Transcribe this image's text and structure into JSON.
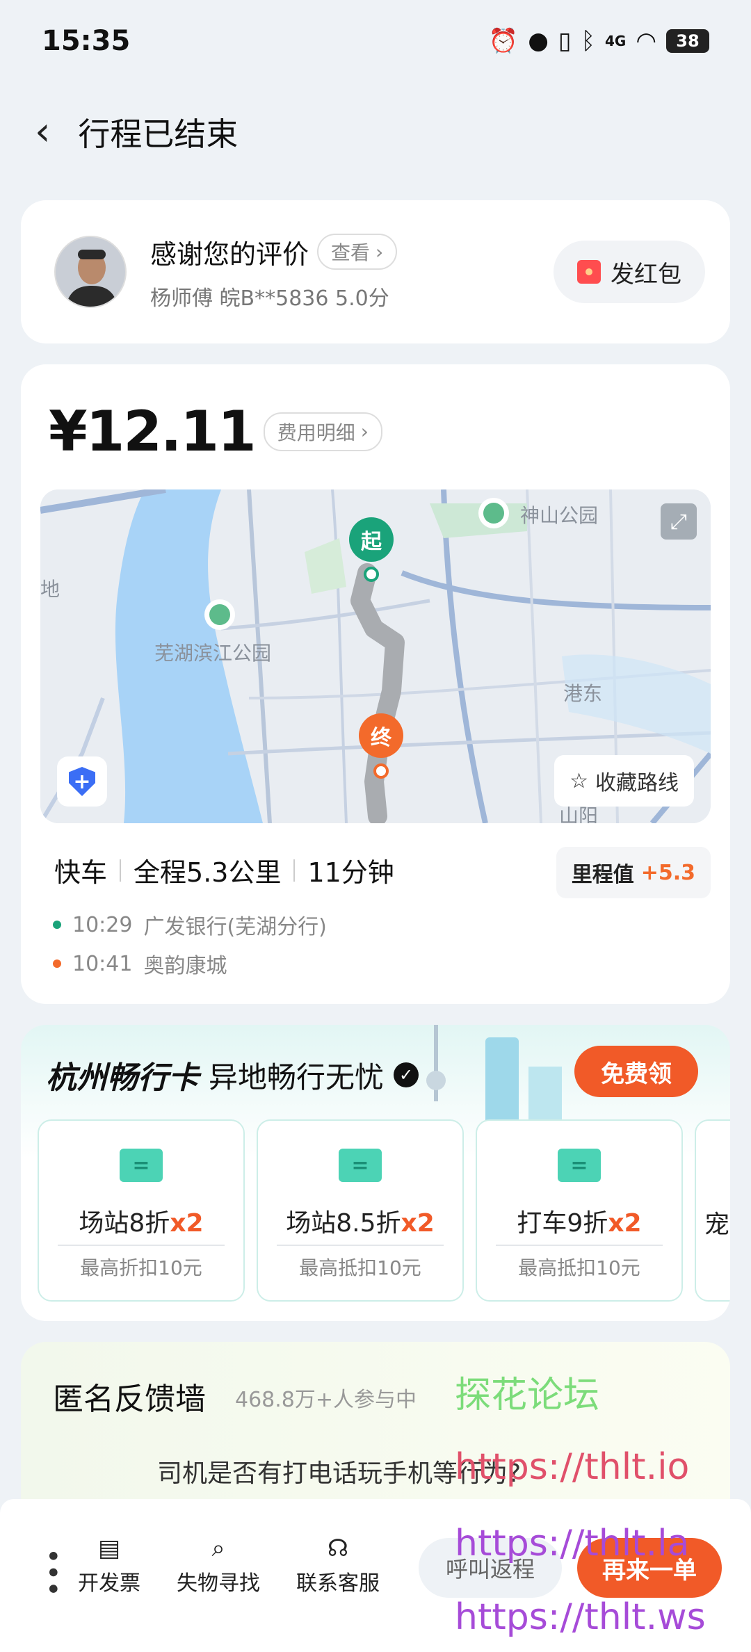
{
  "status_bar": {
    "time": "15:35",
    "icons": [
      "alarm-icon",
      "location-icon",
      "vibrate-icon",
      "bluetooth-icon",
      "signal-4g-icon",
      "wifi-icon"
    ],
    "network": "4G",
    "battery": "38"
  },
  "header": {
    "title": "行程已结束"
  },
  "driver": {
    "thanks": "感谢您的评价",
    "view_label": "查看",
    "sub": "杨师傅 皖B**5836 5.0分",
    "red_packet_label": "发红包"
  },
  "trip": {
    "price": "¥12.11",
    "fee_detail_label": "费用明细",
    "map": {
      "labels": [
        "神山公园",
        "芜湖滨江公园",
        "港东",
        "山阳",
        "地"
      ],
      "start_label": "起",
      "end_label": "终",
      "fav_route_label": "收藏路线"
    },
    "summary": {
      "type": "快车",
      "distance": "全程5.3公里",
      "duration": "11分钟"
    },
    "mileage": {
      "label": "里程值",
      "value": "+5.3"
    },
    "stops": [
      {
        "time": "10:29",
        "place": "广发银行(芜湖分行)",
        "color": "#1aa37a"
      },
      {
        "time": "10:41",
        "place": "奥韵康城",
        "color": "#f36a2b"
      }
    ]
  },
  "promo": {
    "brand": "杭州畅行卡",
    "subtitle": "异地畅行无忧",
    "free_btn": "免费领",
    "coupons": [
      {
        "title": "场站8折",
        "mult": "x2",
        "note": "最高折扣10元"
      },
      {
        "title": "场站8.5折",
        "mult": "x2",
        "note": "最高抵扣10元"
      },
      {
        "title": "打车9折",
        "mult": "x2",
        "note": "最高抵扣10元"
      },
      {
        "title": "宠",
        "mult": "",
        "note": ""
      }
    ]
  },
  "feedback": {
    "title": "匿名反馈墙",
    "count": "468.8万+人参与中",
    "question": "司机是否有打电话玩手机等行为?"
  },
  "watermarks": {
    "forum": "探花论坛",
    "url1": "https://thlt.io",
    "url2": "https://thlt.la",
    "url3": "https://thlt.ws"
  },
  "bottom_bar": {
    "invoice": "开发票",
    "lost_found": "失物寻找",
    "support": "联系客服",
    "return_trip": "呼叫返程",
    "again": "再来一单"
  }
}
